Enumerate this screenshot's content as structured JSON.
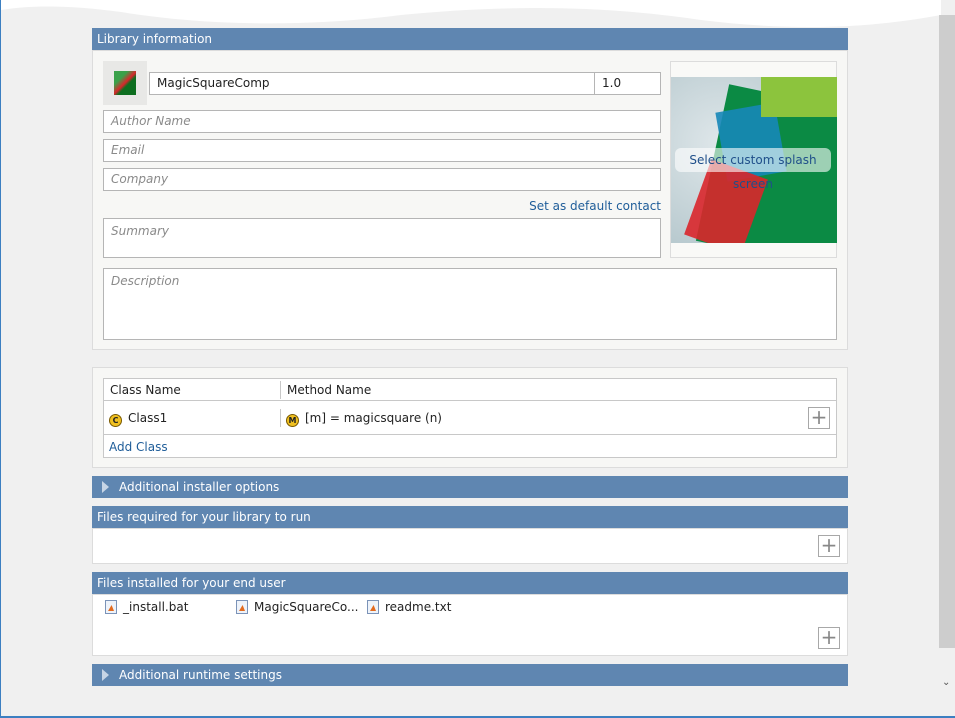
{
  "library_info": {
    "header": "Library information",
    "name": "MagicSquareComp",
    "version": "1.0",
    "author_placeholder": "Author Name",
    "email_placeholder": "Email",
    "company_placeholder": "Company",
    "set_default_contact": "Set as default contact",
    "summary_placeholder": "Summary",
    "description_placeholder": "Description",
    "splash_label": "Select custom splash screen"
  },
  "class_table": {
    "columns": [
      "Class Name",
      "Method Name"
    ],
    "rows": [
      {
        "class": "Class1",
        "class_badge": "C",
        "method": "[m] = magicsquare (n)",
        "method_badge": "M"
      }
    ],
    "add_class": "Add Class",
    "add_symbol": "+"
  },
  "sections": {
    "installer_options": "Additional installer options",
    "files_required": "Files required for your library to run",
    "files_installed": "Files installed for your end user",
    "runtime_settings": "Additional runtime settings"
  },
  "installed_files": [
    "_install.bat",
    "MagicSquareCo...",
    "readme.txt"
  ],
  "colors": {
    "header_bg": "#5f86b1",
    "link": "#1f5d99"
  }
}
